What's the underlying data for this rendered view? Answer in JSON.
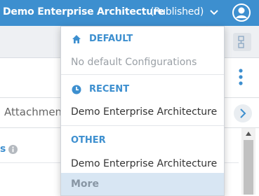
{
  "header": {
    "title": "Demo Enterprise Architecture",
    "status": "(Published)",
    "dropdown_icon": "chevron-down-icon",
    "user_icon": "user-circle-icon"
  },
  "page": {
    "tab_attachments": "Attachmen",
    "section_prefix": "s"
  },
  "dropdown": {
    "default": {
      "label": "DEFAULT",
      "icon": "home-icon",
      "empty_text": "No default Configurations"
    },
    "recent": {
      "label": "RECENT",
      "icon": "clock-icon",
      "items": [
        "Demo Enterprise Architecture"
      ]
    },
    "other": {
      "label": "OTHER",
      "items": [
        "Demo Enterprise Architecture"
      ]
    },
    "more_label": "More"
  },
  "colors": {
    "accent": "#3d8fcf",
    "hover": "#d8e6f3"
  }
}
